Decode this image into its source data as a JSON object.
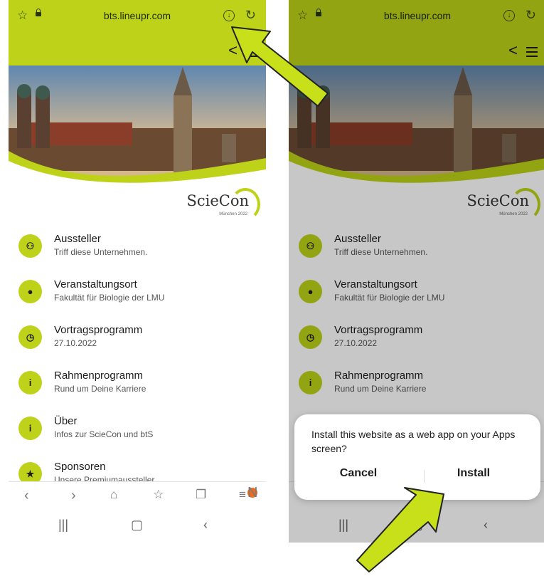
{
  "browser": {
    "url": "bts.lineupr.com"
  },
  "logo": {
    "name": "ScieCon",
    "subtitle": "München 2022"
  },
  "items": [
    {
      "title": "Aussteller",
      "subtitle": "Triff diese Unternehmen.",
      "icon": "people-icon"
    },
    {
      "title": "Veranstaltungsort",
      "subtitle": "Fakultät für Biologie der LMU",
      "icon": "location-pin-icon"
    },
    {
      "title": "Vortragsprogramm",
      "subtitle": "27.10.2022",
      "icon": "clock-icon"
    },
    {
      "title": "Rahmenprogramm",
      "subtitle": "Rund um Deine Karriere",
      "icon": "info-icon"
    },
    {
      "title": "Über",
      "subtitle": "Infos zur ScieCon und btS",
      "icon": "info-icon"
    },
    {
      "title": "Sponsoren",
      "subtitle": "Unsere Premiumaussteller",
      "icon": "star-icon"
    }
  ],
  "nav": {
    "badge": "N"
  },
  "dialog": {
    "message": "Install this website as a web app on your Apps screen?",
    "cancel": "Cancel",
    "install": "Install"
  },
  "colors": {
    "accent": "#bdd218",
    "arrow": "#c8e01a"
  }
}
